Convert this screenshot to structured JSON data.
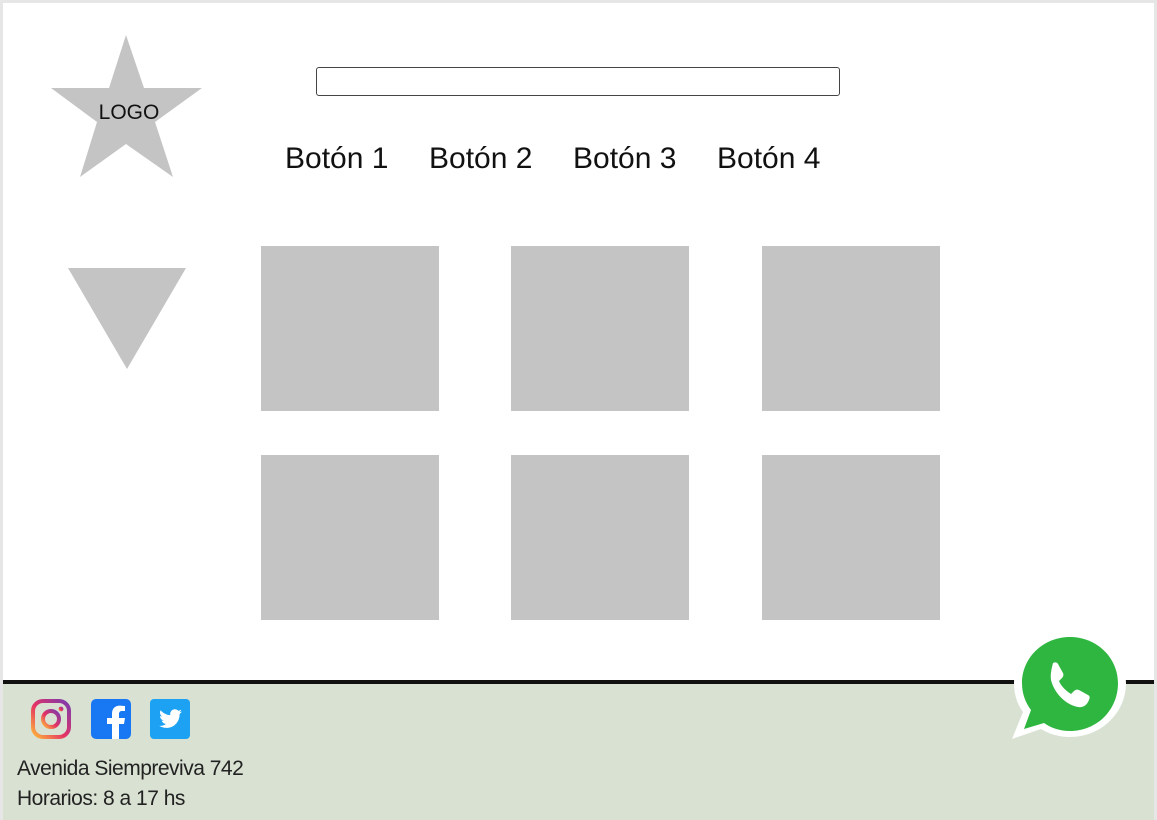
{
  "logo": {
    "label": "LOGO"
  },
  "search": {
    "value": "",
    "placeholder": ""
  },
  "nav": {
    "buttons": [
      {
        "label": "Botón 1"
      },
      {
        "label": "Botón 2"
      },
      {
        "label": "Botón 3"
      },
      {
        "label": "Botón 4"
      }
    ]
  },
  "gallery": {
    "tile_count": 6,
    "tile_color": "#c4c4c4"
  },
  "footer": {
    "background": "#d8e1d2",
    "social": [
      "instagram-icon",
      "facebook-icon",
      "twitter-icon"
    ],
    "address": "Avenida Siempreviva 742",
    "hours": "Horarios: 8 a 17 hs"
  },
  "floating": {
    "icon": "whatsapp-icon",
    "color": "#2fb640"
  }
}
